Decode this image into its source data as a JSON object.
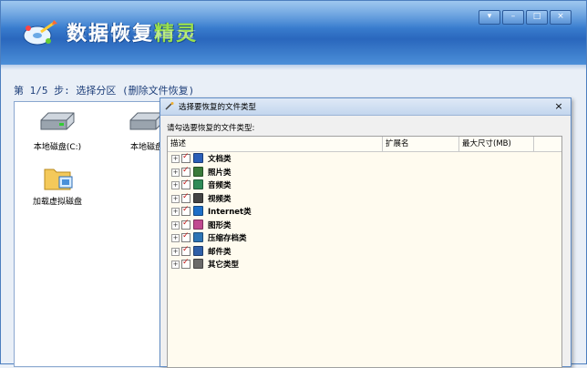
{
  "app": {
    "title_main": "数据恢复",
    "title_accent": "精灵",
    "window_buttons": [
      "▾",
      "–",
      "□",
      "×"
    ]
  },
  "step": {
    "label": "第 1/5 步: 选择分区 (删除文件恢复)"
  },
  "disks": [
    {
      "label": "本地磁盘(C:)"
    },
    {
      "label": "本地磁盘"
    },
    {
      "label": "加载虚拟磁盘"
    }
  ],
  "dialog": {
    "title": "选择要恢复的文件类型",
    "close": "×",
    "prompt": "请勾选要恢复的文件类型:",
    "columns": [
      "描述",
      "扩展名",
      "最大尺寸(MB)"
    ],
    "rows": [
      {
        "label": "文档类",
        "icon": "word-doc-icon",
        "color": "#2b5fb8"
      },
      {
        "label": "照片类",
        "icon": "photo-icon",
        "color": "#3a7a3a"
      },
      {
        "label": "音频类",
        "icon": "audio-icon",
        "color": "#2e8b57"
      },
      {
        "label": "视频类",
        "icon": "video-icon",
        "color": "#444444"
      },
      {
        "label": "Internet类",
        "icon": "internet-icon",
        "color": "#1e6fc7"
      },
      {
        "label": "图形类",
        "icon": "graphics-icon",
        "color": "#c04a90"
      },
      {
        "label": "压缩存档类",
        "icon": "archive-icon",
        "color": "#2e74b5"
      },
      {
        "label": "邮件类",
        "icon": "mail-icon",
        "color": "#3060a8"
      },
      {
        "label": "其它类型",
        "icon": "other-file-icon",
        "color": "#6a6a6a"
      }
    ]
  }
}
